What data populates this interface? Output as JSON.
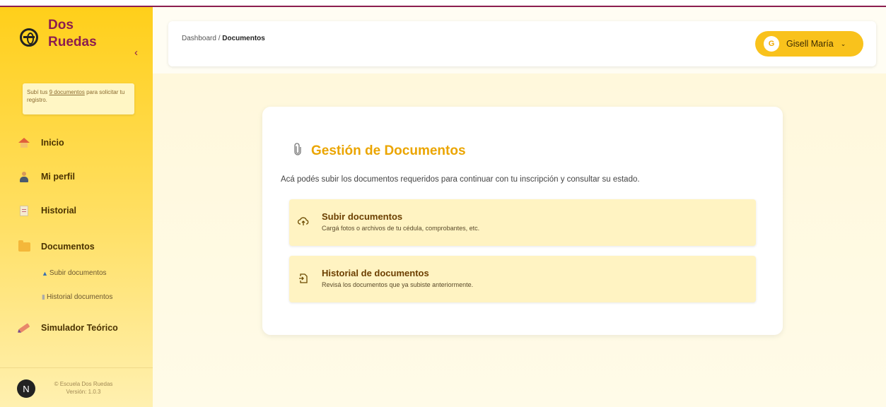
{
  "brand": {
    "name": "Dos Ruedas"
  },
  "notice": {
    "prefix": "Subí tus ",
    "link": "9 documentos",
    "suffix": " para solicitar tu registro."
  },
  "sidebar": {
    "items": [
      {
        "label": "Inicio",
        "icon": "house-icon"
      },
      {
        "label": "Mi perfil",
        "icon": "person-icon"
      },
      {
        "label": "Historial",
        "icon": "document-icon"
      },
      {
        "label": "Documentos",
        "icon": "folder-icon"
      },
      {
        "label": "Simulador Teórico",
        "icon": "pencil-icon"
      }
    ],
    "subitems": [
      {
        "label": "Subir documentos",
        "icon": "upload-person-icon"
      },
      {
        "label": "Historial documentos",
        "icon": "history-doc-icon"
      }
    ]
  },
  "footer": {
    "avatar": "N",
    "line1": "© Escuela Dos Ruedas",
    "line2": "Versión: 1.0.3"
  },
  "header": {
    "breadcrumb_root": "Dashboard",
    "breadcrumb_sep": " / ",
    "breadcrumb_current": "Documentos",
    "user_initial": "G",
    "user_name": "Gisell María",
    "user_chevron": "⌄"
  },
  "main": {
    "title": "Gestión de Documentos",
    "description": "Acá podés subir los documentos requeridos para continuar con tu inscripción y consultar su estado.",
    "options": [
      {
        "title": "Subir documentos",
        "subtitle": "Cargá fotos o archivos de tu cédula, comprobantes, etc.",
        "icon": "cloud-upload-icon"
      },
      {
        "title": "Historial de documentos",
        "subtitle": "Revisá los documentos que ya subiste anteriormente.",
        "icon": "file-history-icon"
      }
    ]
  },
  "colors": {
    "accent": "#f9c21c",
    "title": "#eba500",
    "brand": "#8c1d4f"
  }
}
